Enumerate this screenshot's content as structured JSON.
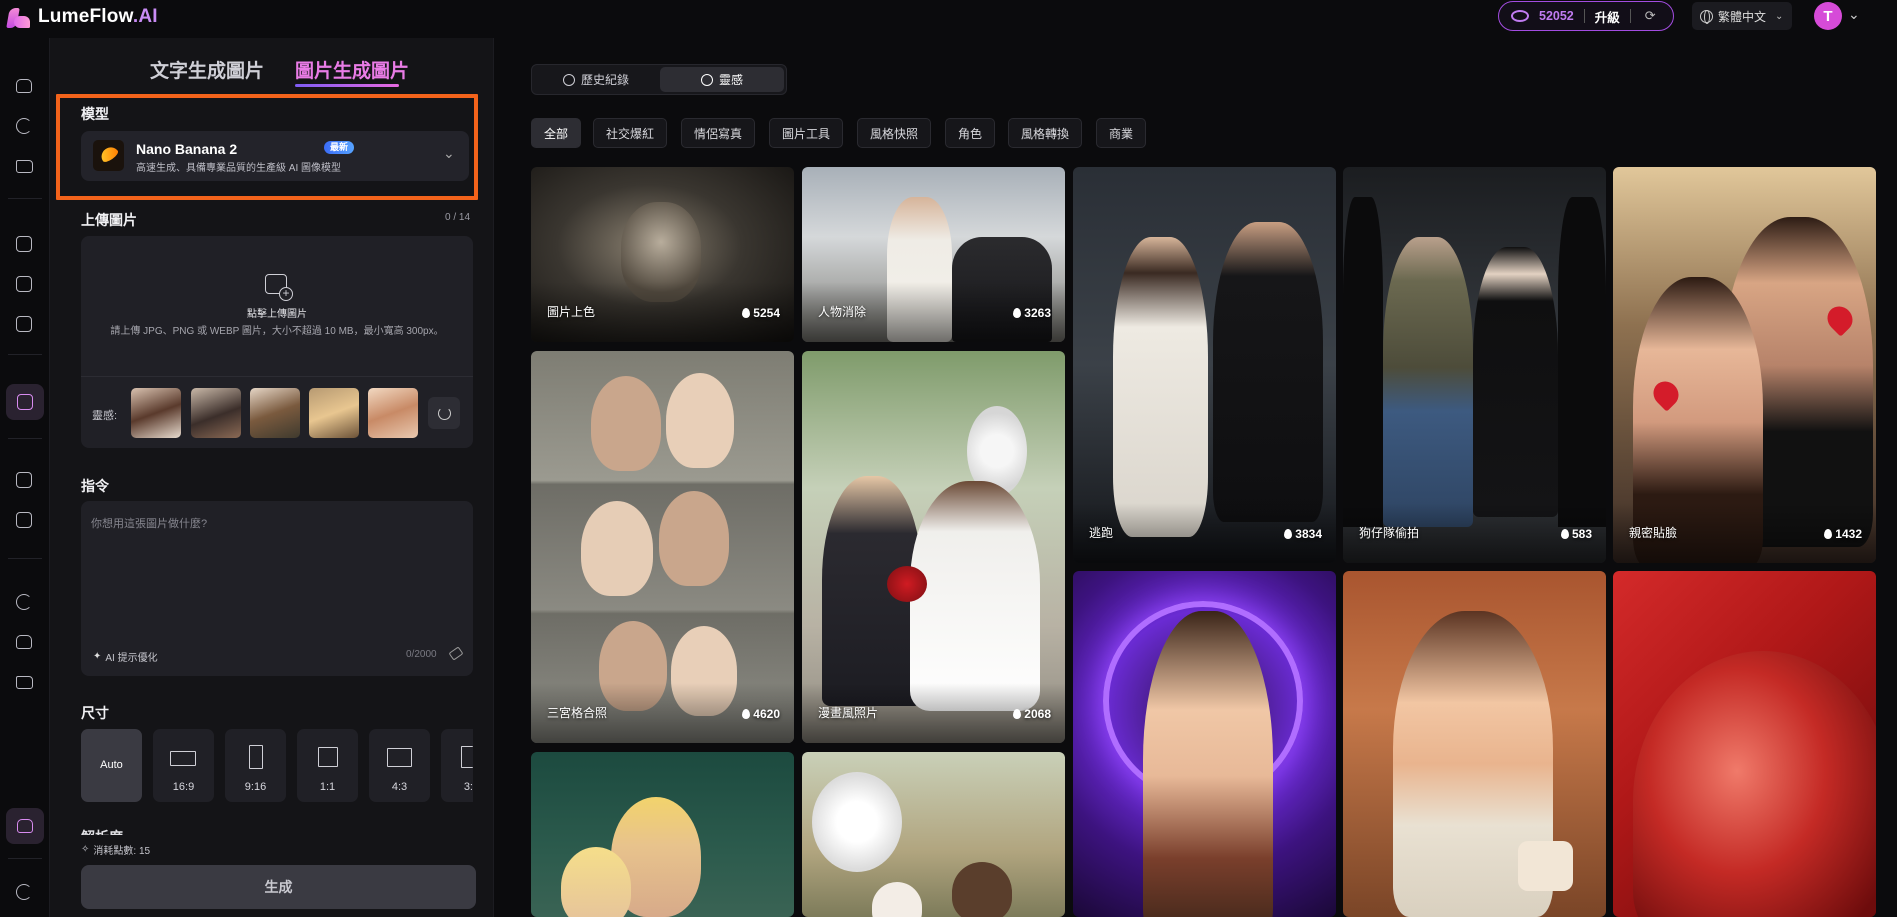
{
  "app": {
    "brand": "LumeFlow",
    "brand_suffix": ".AI"
  },
  "header": {
    "credits": "52052",
    "upgrade": "升級",
    "language": "繁體中文",
    "avatar_letter": "T"
  },
  "panel": {
    "tabs": [
      "文字生成圖片",
      "圖片生成圖片"
    ],
    "model": {
      "label": "模型",
      "name": "Nano Banana 2",
      "badge": "最新",
      "desc": "高速生成、具備專業品質的生產級 AI 圖像模型"
    },
    "upload": {
      "label": "上傳圖片",
      "count": "0 / 14",
      "title": "點擊上傳圖片",
      "sub": "請上傳 JPG、PNG 或 WEBP 圖片，大小不超過 10 MB，最小寬高 300px。",
      "inspiration_label": "靈感:"
    },
    "prompt": {
      "label": "指令",
      "placeholder": "你想用這張圖片做什麼?",
      "ai_opt": "AI 提示優化",
      "char_count": "0/2000"
    },
    "size": {
      "label": "尺寸",
      "options": [
        "Auto",
        "16:9",
        "9:16",
        "1:1",
        "4:3",
        "3:"
      ]
    },
    "resolution_label": "解析度",
    "cost": "消耗點數:  15",
    "generate": "生成"
  },
  "gallery": {
    "segments": [
      "歷史紀錄",
      "靈感"
    ],
    "chips": [
      "全部",
      "社交爆紅",
      "情侶寫真",
      "圖片工具",
      "風格快照",
      "角色",
      "風格轉換",
      "商業"
    ],
    "cards": [
      {
        "caption": "圖片上色",
        "likes": "5254"
      },
      {
        "caption": "人物消除",
        "likes": "3263"
      },
      {
        "caption": "逃跑",
        "likes": "3834"
      },
      {
        "caption": "狗仔隊偷拍",
        "likes": "583"
      },
      {
        "caption": "親密貼臉",
        "likes": "1432"
      },
      {
        "caption": "三宮格合照",
        "likes": "4620"
      },
      {
        "caption": "漫畫風照片",
        "likes": "2068"
      },
      {
        "caption": "",
        "likes": ""
      },
      {
        "caption": "",
        "likes": ""
      },
      {
        "caption": "",
        "likes": ""
      },
      {
        "caption": "",
        "likes": ""
      },
      {
        "caption": "",
        "likes": ""
      }
    ]
  },
  "colors": {
    "accent": "#e97ce6",
    "highlight": "#f3631b",
    "credits": "#c07bf0"
  }
}
